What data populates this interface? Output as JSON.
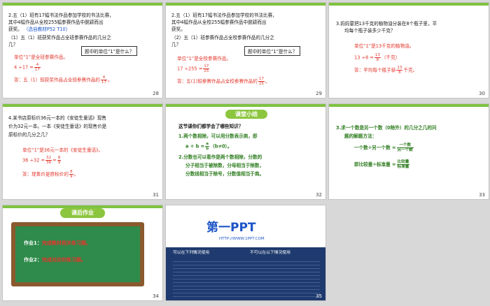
{
  "slides": [
    {
      "num": "28",
      "q1": "2.五（1）班有17幅书法作品参加学校的书法比赛，",
      "q2": "其中4幅作品从全校255幅参赛作品中脱颖而出",
      "q3": "获奖。",
      "ref": "（选自教材P52 T10）",
      "sub1": "（1）五（1）班获奖作品占全班参赛作品的几分之",
      "sub2": "几？",
      "callout": "题中的单位“1”是什么？",
      "ans_unit": "单位“1”是全班参赛作品。",
      "eq_lhs": "4 ÷17 =",
      "eq_n": "4",
      "eq_d": "17",
      "answer": "答：五（1）班获奖作品占全班参赛作品的",
      "ans_n": "4",
      "ans_d": "17",
      "ans_end": "。"
    },
    {
      "num": "29",
      "q1": "2.五（1）班有17幅书法作品参加学校的书法比赛，",
      "q2": "其中4幅作品从全校255幅参赛作品中脱颖而出",
      "q3": "获奖。",
      "sub1": "（2）五（1）班参赛作品占全校参赛作品的几分之",
      "sub2": "几？",
      "callout": "题中的单位“1”是什么？",
      "ans_unit": "单位“1”是全校参赛作品。",
      "eq_lhs": "17 ÷255 =",
      "eq_n": "17",
      "eq_d": "25",
      "answer": "答：五(1)班参赛作品占全校参赛作品的",
      "ans_n": "17",
      "ans_d": "25",
      "ans_end": "。"
    },
    {
      "num": "30",
      "q1": "3.妈妈要把13千克的植物油分装在8个瓶子里，平",
      "q2": "均每个瓶子装多少千克？",
      "ans_unit": "单位“1”是13千克的植物油。",
      "eq_lhs": "13 ÷8 =",
      "eq_n": "13",
      "eq_d": "8",
      "eq_unit": "（千克）",
      "answer": "答：平均每个瓶子装",
      "ans_n": "13",
      "ans_d": "8",
      "ans_end": "千克。"
    },
    {
      "num": "31",
      "q1": "4.某书店原标价36元一本的《安徒生童话》现售",
      "q2": "价为32元一本。一本《安徒生童话》的现售价是",
      "q3": "原标价的几分之几？",
      "ans_unit": "单位“1”是36元一本的《安徒生童话》。",
      "eq_lhs": "36 ÷32 =",
      "eq_n": "32",
      "eq_d": "36",
      "eq_n2": "8",
      "eq_d2": "9",
      "answer": "答：现售价是原标价的",
      "ans_n": "8",
      "ans_d": "9",
      "ans_end": "。"
    },
    {
      "num": "32",
      "title": "课堂小结",
      "q1": "这节课你们都学会了哪些知识？",
      "p1": "1.两个数相除，可以用分数表示商，即",
      "p1b_a": "a ÷ b =",
      "p1b_n": "a",
      "p1b_d": "b",
      "p1b_end": "（b≠0）。",
      "p2a": "2.分数也可以看作是两个数相除，分数的",
      "p2b": "分子相当于被除数，分母相当于除数，",
      "p2c": "分数线相当于除号，分数值相当于商。"
    },
    {
      "num": "33",
      "p1": "3.求一个数是另一个数（0除外）的几分之几的问",
      "p2": "题的解题方法：",
      "m1_lhs": "一个数÷另一个数 =",
      "m1_n": "一个数",
      "m1_d": "另一个数",
      "m2_lhs": "即比较量÷标准量 =",
      "m2_n": "比较量",
      "m2_d": "标准量"
    },
    {
      "num": "34",
      "title": "课后作业",
      "hw1_label": "作业1：",
      "hw1": "完成教材相关练习题。",
      "hw2_label": "作业2：",
      "hw2": "完成对应的练习题。"
    },
    {
      "num": "35",
      "logo": "第一PPT",
      "url": "HTTP://WWW.1PPT.COM",
      "col1_title": "可以在下列情况使用",
      "col2_title": "不可以在以下情况使用"
    }
  ],
  "colors": {
    "accent_green": "#7fc241",
    "answer_red": "#e2372d",
    "ref_blue": "#1c54c8",
    "title_pill": "#8cc63f"
  }
}
